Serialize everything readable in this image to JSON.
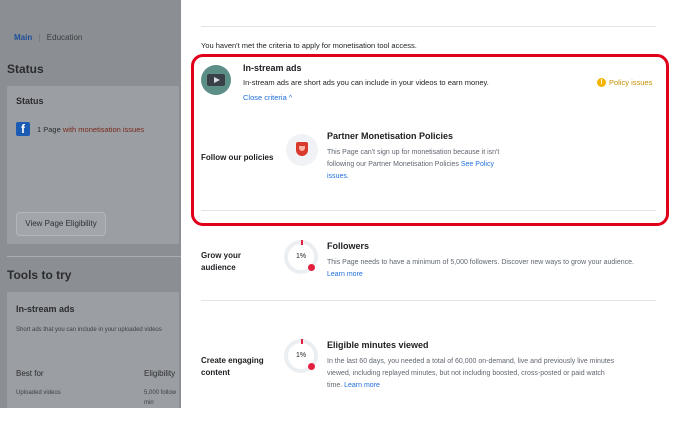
{
  "left": {
    "breadcrumb": {
      "main": "Main",
      "sep": "|",
      "current": "Education"
    },
    "status_heading": "Status",
    "status_card": {
      "title": "Status",
      "fb_glyph": "f",
      "issue_prefix": "1 Page ",
      "issue_highlight": "with monetisation issues",
      "button": "View Page Eligibility"
    },
    "tools_heading": "Tools to try",
    "tool": {
      "title": "In-stream ads",
      "description": "Short ads that you can include in your uploaded videos",
      "best_for_label": "Best for",
      "best_for_value": "Uploaded videos",
      "eligibility_label": "Eligibility",
      "eligibility_value": "5,000 follow",
      "eligibility_value2": "min"
    }
  },
  "main": {
    "criteria_notice": "You haven't met the criteria to apply for monetisation tool access.",
    "instream": {
      "title": "In-stream ads",
      "subtitle": "In-stream ads are short ads you can include in your videos to earn money.",
      "close_label": "Close criteria",
      "close_chevron": "^",
      "policy_status": "Policy issues"
    },
    "policies": {
      "row_label": "Follow our policies",
      "title": "Partner Monetisation Policies",
      "text": "This Page can't sign up for monetisation because it isn't following our Partner Monetisation Policies",
      "link_see": "See",
      "link_issues": "Policy issues."
    },
    "grow": {
      "row_label_1": "Grow your",
      "row_label_2": "audience",
      "percent": "1%",
      "title": "Followers",
      "text": "This Page needs to have a minimum of 5,000 followers. Discover new ways to grow your audience.",
      "link": "Learn more"
    },
    "engaging": {
      "row_label_1": "Create engaging",
      "row_label_2": "content",
      "percent": "1%",
      "title": "Eligible minutes viewed",
      "text_1": "In the last 60 days, you needed a total of 60,000 on-demand, live and previously live minutes",
      "text_2": "viewed, including replayed minutes, but not including boosted, cross-posted or paid watch",
      "text_3": "time.",
      "link": "Learn more"
    }
  },
  "colors": {
    "highlight_border": "#e0001a",
    "link": "#216fdb",
    "warning": "#f5b400",
    "issue_text": "#c8361f"
  },
  "icons": {
    "video": "video-ads-icon",
    "shield": "shield-icon",
    "warning": "warning-icon",
    "facebook": "facebook-icon"
  }
}
